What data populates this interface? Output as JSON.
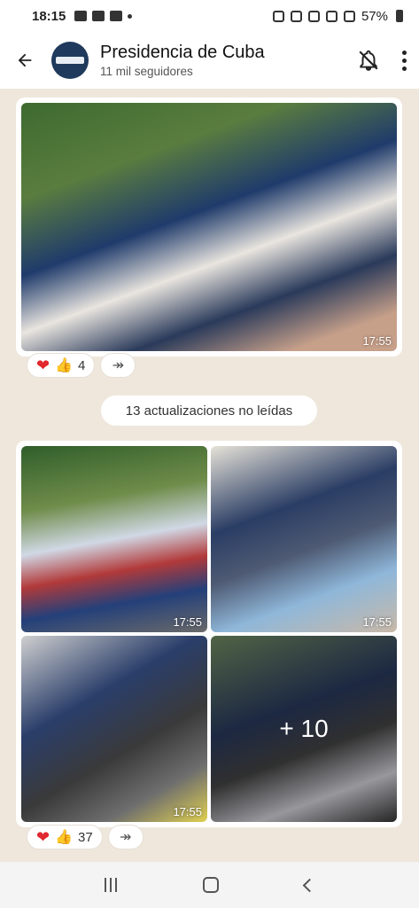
{
  "status_bar": {
    "time": "18:15",
    "battery": "57%"
  },
  "header": {
    "back_icon": "arrow-left-icon",
    "channel_name": "Presidencia de Cuba",
    "followers": "11 mil seguidores",
    "mute_icon": "bell-off-icon",
    "menu_icon": "more-vertical-icon"
  },
  "post1": {
    "time": "17:55",
    "reactions": {
      "emojis": [
        "heart",
        "thumbs-up"
      ],
      "count": "4"
    }
  },
  "unread_banner": "13 actualizaciones no leídas",
  "post2": {
    "photos": [
      {
        "time": "17:55"
      },
      {
        "time": "17:55"
      },
      {
        "time": "17:55"
      },
      {
        "overlay": "+ 10"
      }
    ],
    "reactions": {
      "emojis": [
        "heart",
        "thumbs-up"
      ],
      "count": "37"
    }
  },
  "colors": {
    "background": "#efe7dc",
    "heart": "#e0282e",
    "thumb": "#f1b531"
  }
}
